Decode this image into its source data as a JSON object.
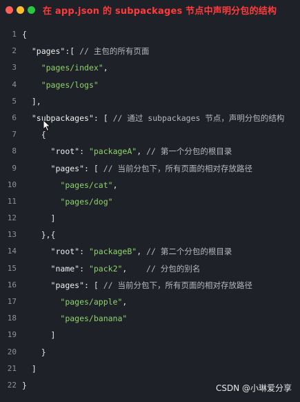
{
  "window": {
    "title": "在 app.json 的 subpackages 节点中声明分包的结构",
    "buttons": [
      "close",
      "minimize",
      "maximize"
    ]
  },
  "code": {
    "lines": [
      {
        "n": "1",
        "segments": [
          {
            "t": "{",
            "c": "p"
          }
        ]
      },
      {
        "n": "2",
        "segments": [
          {
            "t": "  ",
            "c": "p"
          },
          {
            "t": "\"pages\"",
            "c": "k"
          },
          {
            "t": ":[ ",
            "c": "p"
          },
          {
            "t": "// 主包的所有页面",
            "c": "c"
          }
        ]
      },
      {
        "n": "3",
        "segments": [
          {
            "t": "    ",
            "c": "p"
          },
          {
            "t": "\"pages/index\"",
            "c": "s"
          },
          {
            "t": ",",
            "c": "p"
          }
        ]
      },
      {
        "n": "4",
        "segments": [
          {
            "t": "    ",
            "c": "p"
          },
          {
            "t": "\"pages/logs\"",
            "c": "s"
          }
        ]
      },
      {
        "n": "5",
        "segments": [
          {
            "t": "  ],",
            "c": "p"
          }
        ]
      },
      {
        "n": "6",
        "segments": [
          {
            "t": "  ",
            "c": "p"
          },
          {
            "t": "\"subpackages\"",
            "c": "k"
          },
          {
            "t": ": [ ",
            "c": "p"
          },
          {
            "t": "// 通过 subpackages 节点，声明分包的结构",
            "c": "c"
          }
        ]
      },
      {
        "n": "7",
        "segments": [
          {
            "t": "    {",
            "c": "p"
          }
        ]
      },
      {
        "n": "8",
        "segments": [
          {
            "t": "      ",
            "c": "p"
          },
          {
            "t": "\"root\"",
            "c": "k"
          },
          {
            "t": ": ",
            "c": "p"
          },
          {
            "t": "\"packageA\"",
            "c": "s"
          },
          {
            "t": ", ",
            "c": "p"
          },
          {
            "t": "// 第一个分包的根目录",
            "c": "c"
          }
        ]
      },
      {
        "n": "9",
        "segments": [
          {
            "t": "      ",
            "c": "p"
          },
          {
            "t": "\"pages\"",
            "c": "k"
          },
          {
            "t": ": [ ",
            "c": "p"
          },
          {
            "t": "// 当前分包下，所有页面的相对存放路径",
            "c": "c"
          }
        ]
      },
      {
        "n": "10",
        "segments": [
          {
            "t": "        ",
            "c": "p"
          },
          {
            "t": "\"pages/cat\"",
            "c": "s"
          },
          {
            "t": ",",
            "c": "p"
          }
        ]
      },
      {
        "n": "11",
        "segments": [
          {
            "t": "        ",
            "c": "p"
          },
          {
            "t": "\"pages/dog\"",
            "c": "s"
          }
        ]
      },
      {
        "n": "12",
        "segments": [
          {
            "t": "      ]",
            "c": "p"
          }
        ]
      },
      {
        "n": "13",
        "segments": [
          {
            "t": "    },{",
            "c": "p"
          }
        ]
      },
      {
        "n": "14",
        "segments": [
          {
            "t": "      ",
            "c": "p"
          },
          {
            "t": "\"root\"",
            "c": "k"
          },
          {
            "t": ": ",
            "c": "p"
          },
          {
            "t": "\"packageB\"",
            "c": "s"
          },
          {
            "t": ", ",
            "c": "p"
          },
          {
            "t": "// 第二个分包的根目录",
            "c": "c"
          }
        ]
      },
      {
        "n": "15",
        "segments": [
          {
            "t": "      ",
            "c": "p"
          },
          {
            "t": "\"name\"",
            "c": "k"
          },
          {
            "t": ": ",
            "c": "p"
          },
          {
            "t": "\"pack2\"",
            "c": "s"
          },
          {
            "t": ",    ",
            "c": "p"
          },
          {
            "t": "// 分包的别名",
            "c": "c"
          }
        ]
      },
      {
        "n": "16",
        "segments": [
          {
            "t": "      ",
            "c": "p"
          },
          {
            "t": "\"pages\"",
            "c": "k"
          },
          {
            "t": ": [ ",
            "c": "p"
          },
          {
            "t": "// 当前分包下，所有页面的相对存放路径",
            "c": "c"
          }
        ]
      },
      {
        "n": "17",
        "segments": [
          {
            "t": "        ",
            "c": "p"
          },
          {
            "t": "\"pages/apple\"",
            "c": "s"
          },
          {
            "t": ",",
            "c": "p"
          }
        ]
      },
      {
        "n": "18",
        "segments": [
          {
            "t": "        ",
            "c": "p"
          },
          {
            "t": "\"pages/banana\"",
            "c": "s"
          }
        ]
      },
      {
        "n": "19",
        "segments": [
          {
            "t": "      ]",
            "c": "p"
          }
        ]
      },
      {
        "n": "20",
        "segments": [
          {
            "t": "    }",
            "c": "p"
          }
        ]
      },
      {
        "n": "21",
        "segments": [
          {
            "t": "  ]",
            "c": "p"
          }
        ]
      },
      {
        "n": "22",
        "segments": [
          {
            "t": "}",
            "c": "p"
          }
        ]
      }
    ]
  },
  "watermark": "CSDN @小琳爱分享",
  "colors": {
    "background": "#1f2129",
    "title": "#ff3b3b",
    "string": "#8fd36b",
    "comment": "#b4b8c0",
    "line_number": "#8e939c"
  },
  "icons": {
    "cursor": "mouse-pointer-icon"
  }
}
